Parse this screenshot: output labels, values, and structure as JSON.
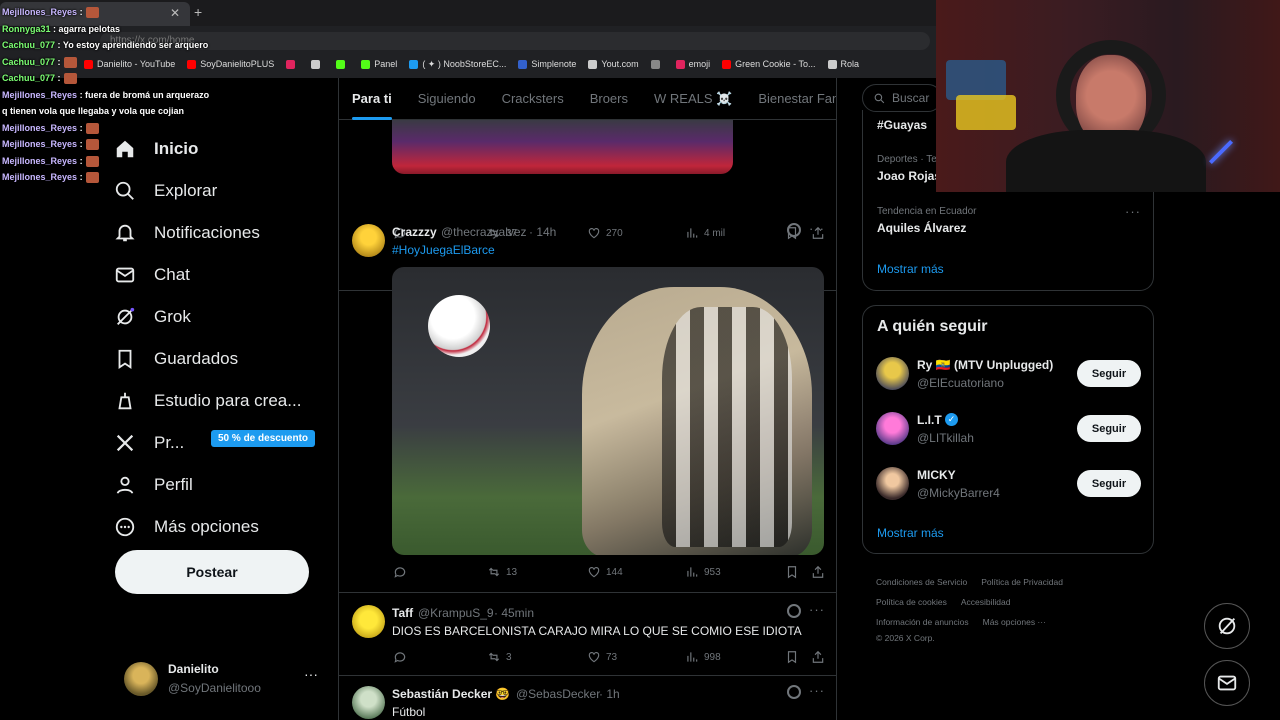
{
  "browser": {
    "tab_title": "",
    "url": "https://x.com/home",
    "bookmarks": [
      {
        "label": "Danielito - YouTube",
        "color": "#ff0000"
      },
      {
        "label": "SoyDanielitoPLUS",
        "color": "#ff0000"
      },
      {
        "label": "",
        "color": "#e0245e"
      },
      {
        "label": "",
        "color": "#cccccc"
      },
      {
        "label": "",
        "color": "#53fc18"
      },
      {
        "label": "Panel",
        "color": "#53fc18"
      },
      {
        "label": "( ✦ ) NoobStoreEC...",
        "color": "#1d9bf0"
      },
      {
        "label": "Simplenote",
        "color": "#3361cc"
      },
      {
        "label": "Yout.com",
        "color": "#cccccc"
      },
      {
        "label": "",
        "color": "#888888"
      },
      {
        "label": "emoji",
        "color": "#e0245e"
      },
      {
        "label": "Green Cookie - To...",
        "color": "#ff0000"
      },
      {
        "label": "Rola",
        "color": "#cccccc"
      }
    ]
  },
  "chat": [
    {
      "user": "Mejillones_Reyes",
      "text": ":",
      "emote": true,
      "color": "purple"
    },
    {
      "user": "Ronnyga31",
      "text": ": agarra pelotas",
      "emote": false,
      "color": "green"
    },
    {
      "user": "Cachuu_077",
      "text": ": Yo estoy aprendiendo ser arquero",
      "emote": false,
      "color": "green"
    },
    {
      "user": "Cachuu_077",
      "text": ":",
      "emote": true,
      "color": "green"
    },
    {
      "user": "Cachuu_077",
      "text": ":",
      "emote": true,
      "color": "green"
    },
    {
      "user": "Mejillones_Reyes",
      "text": ": fuera de bromá un arquerazo",
      "emote": false,
      "color": "purple"
    },
    {
      "user": "",
      "text": "q tienen vola que llegaba y vola que cojian",
      "emote": false,
      "color": "purple"
    },
    {
      "user": "Mejillones_Reyes",
      "text": ":",
      "emote": true,
      "color": "purple"
    },
    {
      "user": "Mejillones_Reyes",
      "text": ":",
      "emote": true,
      "color": "purple"
    },
    {
      "user": "Mejillones_Reyes",
      "text": ":",
      "emote": true,
      "color": "purple"
    },
    {
      "user": "Mejillones_Reyes",
      "text": ":",
      "emote": true,
      "color": "purple"
    }
  ],
  "nav": {
    "items": [
      {
        "label": "Inicio",
        "icon": "home-icon"
      },
      {
        "label": "Explorar",
        "icon": "search-icon"
      },
      {
        "label": "Notificaciones",
        "icon": "bell-icon"
      },
      {
        "label": "Chat",
        "icon": "mail-icon"
      },
      {
        "label": "Grok",
        "icon": "grok-icon"
      },
      {
        "label": "Guardados",
        "icon": "bookmark-icon"
      },
      {
        "label": "Estudio para crea...",
        "icon": "studio-icon"
      },
      {
        "label": "Pr...",
        "icon": "x-logo-icon"
      },
      {
        "label": "Perfil",
        "icon": "person-icon"
      },
      {
        "label": "Más opciones",
        "icon": "more-circle-icon"
      }
    ],
    "premium_badge": "50 % de descuento",
    "post_button": "Postear"
  },
  "account": {
    "name": "Danielito",
    "handle": "@SoyDanielitooo"
  },
  "feed_tabs": [
    "Para ti",
    "Siguiendo",
    "Cracksters",
    "Broers",
    "W REALS ☠️",
    "Bienestar Familiar"
  ],
  "posts": [
    {
      "stats": {
        "replies": "",
        "reposts": "37",
        "likes": "270",
        "views": "4 mil"
      }
    },
    {
      "name": "Crazzzy",
      "handle": "@thecrazyalvez",
      "time": "· 14h",
      "text": "#HoyJuegaElBarce",
      "stats": {
        "replies": "",
        "reposts": "13",
        "likes": "144",
        "views": "953"
      }
    },
    {
      "name": "Taff",
      "handle": "@KrampuS_9",
      "time": "· 45min",
      "text": "DIOS ES BARCELONISTA CARAJO MIRA LO QUE SE COMIO ESE IDIOTA",
      "stats": {
        "replies": "",
        "reposts": "3",
        "likes": "73",
        "views": "998"
      }
    },
    {
      "name": "Sebastián Decker 🤓",
      "handle": "@SebasDecker",
      "time": "· 1h",
      "text": "Fútbol"
    }
  ],
  "search": {
    "placeholder": "Buscar"
  },
  "trends": [
    {
      "category": "",
      "title": "#Guayas"
    },
    {
      "category": "Deportes · Tendencia",
      "title": "Joao Rojas"
    },
    {
      "category": "Tendencia en Ecuador",
      "title": "Aquiles Álvarez"
    }
  ],
  "trends_more": "Mostrar más",
  "who_to_follow": {
    "title": "A quién seguir",
    "users": [
      {
        "name": "Ry 🇪🇨 (MTV Unplugged)",
        "handle": "@ElEcuatoriano",
        "button": "Seguir"
      },
      {
        "name": "L.I.T",
        "handle": "@LITkillah",
        "button": "Seguir",
        "verified": true
      },
      {
        "name": "MICKY",
        "handle": "@MickyBarrer4",
        "button": "Seguir"
      }
    ],
    "more": "Mostrar más"
  },
  "footer": [
    "Condiciones de Servicio",
    "Política de Privacidad",
    "Política de cookies",
    "Accesibilidad",
    "Información de anuncios",
    "Más opciones ···",
    "© 2026 X Corp."
  ],
  "colors": {
    "accent": "#1d9bf0",
    "background": "#000000",
    "border": "#2f3336"
  }
}
